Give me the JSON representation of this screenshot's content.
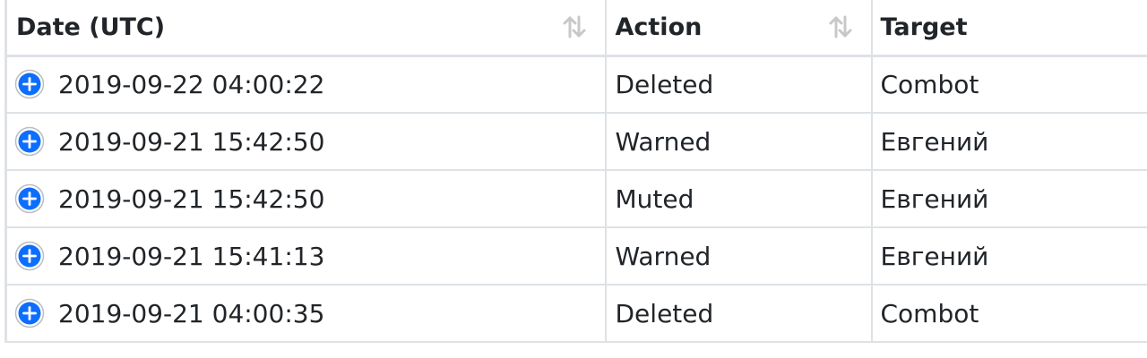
{
  "table": {
    "headers": [
      "Date (UTC)",
      "Action",
      "Target"
    ],
    "sortable_header_icons": [
      "sort-icon",
      "sort-icon"
    ],
    "rows": [
      {
        "date": "2019-09-22 04:00:22",
        "action": "Deleted",
        "target": "Combot"
      },
      {
        "date": "2019-09-21 15:42:50",
        "action": "Warned",
        "target": "Евгений"
      },
      {
        "date": "2019-09-21 15:42:50",
        "action": "Muted",
        "target": "Евгений"
      },
      {
        "date": "2019-09-21 15:41:13",
        "action": "Warned",
        "target": "Евгений"
      },
      {
        "date": "2019-09-21 04:00:35",
        "action": "Deleted",
        "target": "Combot"
      }
    ],
    "row_expand_icon": "plus-circle-icon"
  },
  "colors": {
    "border": "#dee2e6",
    "text": "#212529",
    "expand_icon": "#0d6efd",
    "sort_icon": "#c8c8c8"
  }
}
